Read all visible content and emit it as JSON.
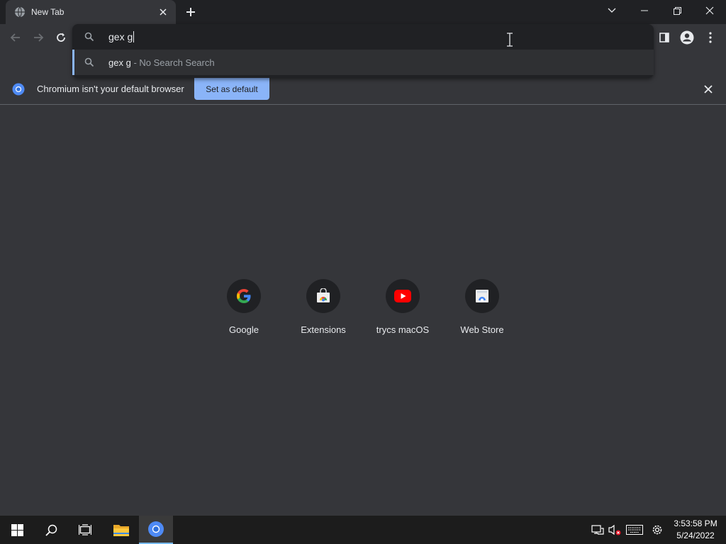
{
  "tab": {
    "title": "New Tab"
  },
  "omnibox": {
    "input_value": "gex g",
    "suggestion": {
      "query": "gex g",
      "description": "- No Search Search"
    }
  },
  "infobar": {
    "message": "Chromium isn't your default browser",
    "button_label": "Set as default"
  },
  "shortcuts": [
    {
      "label": "Google",
      "icon": "google-icon"
    },
    {
      "label": "Extensions",
      "icon": "extensions-icon"
    },
    {
      "label": "trycs macOS",
      "icon": "youtube-icon"
    },
    {
      "label": "Web Store",
      "icon": "web-store-icon"
    }
  ],
  "taskbar": {
    "time": "3:53:58 PM",
    "date": "5/24/2022"
  },
  "colors": {
    "accent": "#8ab4f8",
    "background": "#35363a",
    "frame": "#202124"
  }
}
